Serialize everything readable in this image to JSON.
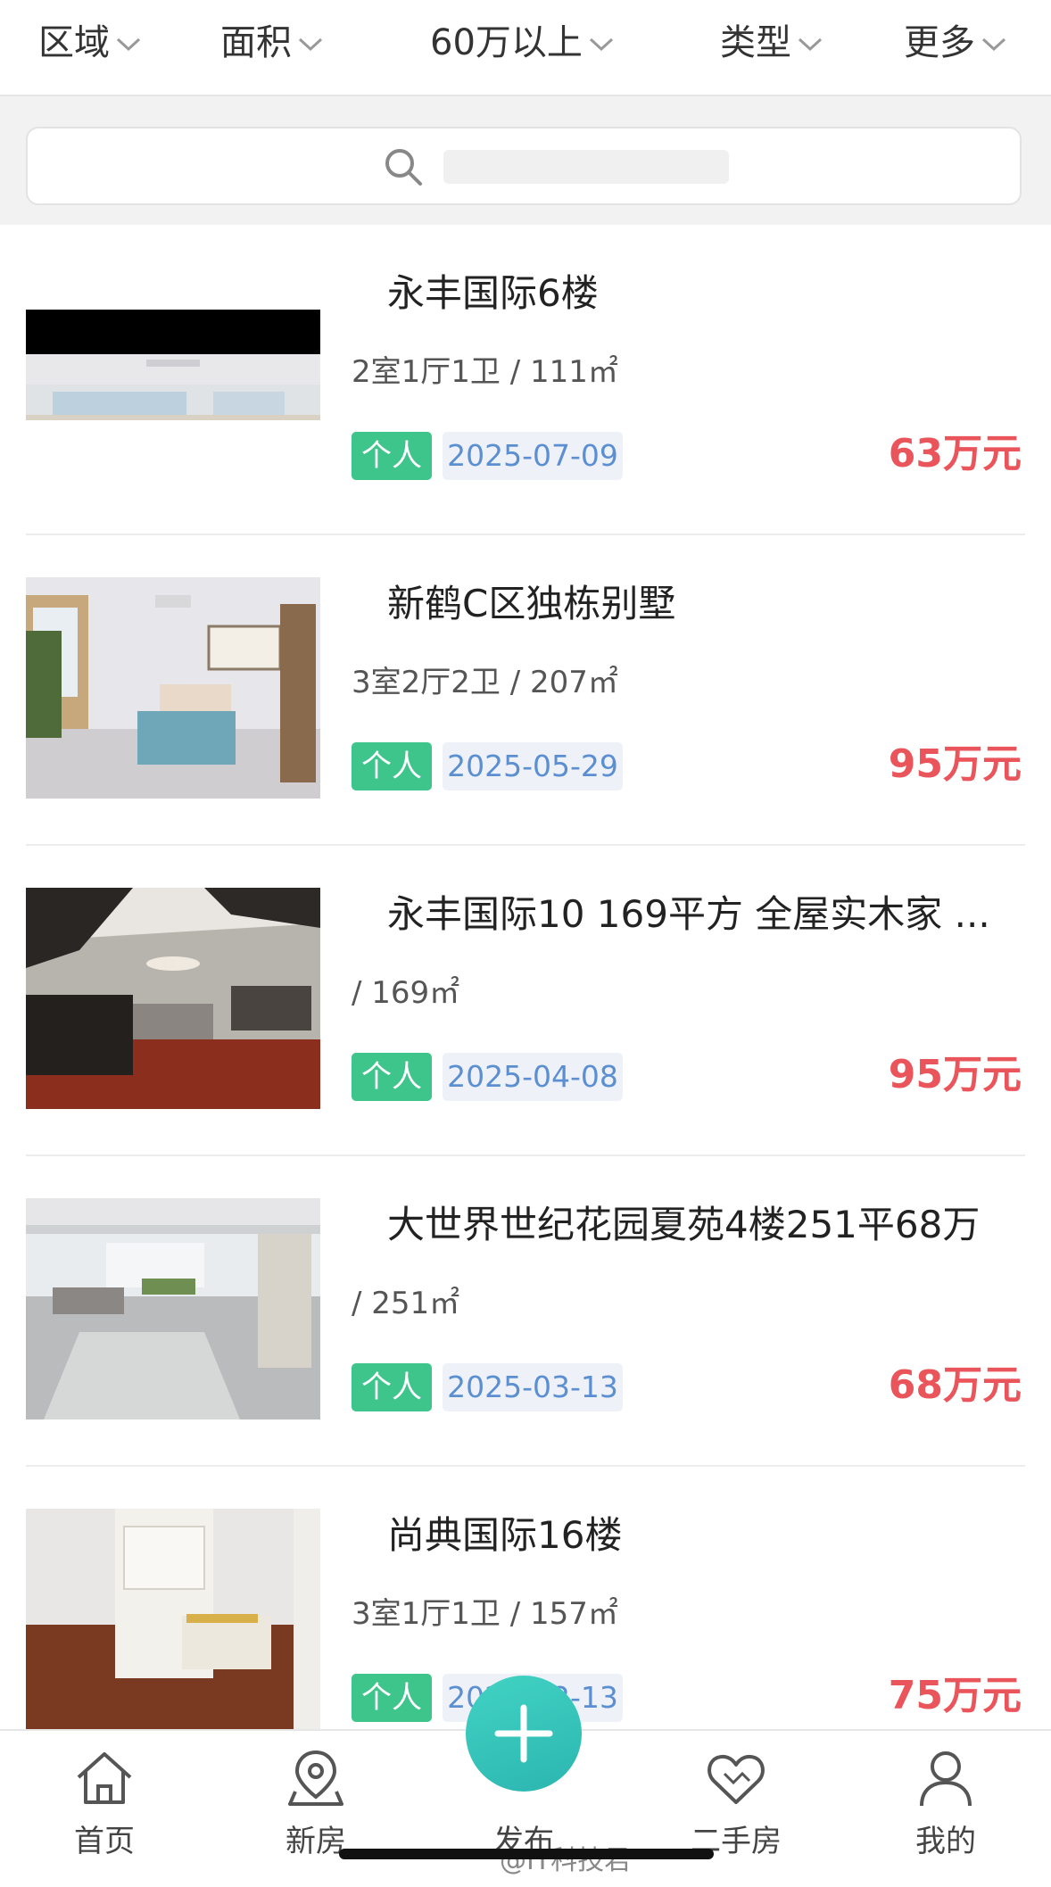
{
  "filters": [
    {
      "label": "区域"
    },
    {
      "label": "面积"
    },
    {
      "label": "60万以上"
    },
    {
      "label": "类型"
    },
    {
      "label": "更多"
    }
  ],
  "search": {
    "placeholder": ""
  },
  "listings": [
    {
      "title": "永丰国际6楼",
      "specs": "2室1厅1卫 / 111㎡",
      "tag": "个人",
      "date": "2025-07-09",
      "price": "63万元"
    },
    {
      "title": "新鹤C区独栋别墅",
      "specs": "3室2厅2卫 / 207㎡",
      "tag": "个人",
      "date": "2025-05-29",
      "price": "95万元"
    },
    {
      "title": "永丰国际10 169平方 全屋实木家 ...",
      "specs": "/ 169㎡",
      "tag": "个人",
      "date": "2025-04-08",
      "price": "95万元"
    },
    {
      "title": "大世界世纪花园夏苑4楼251平68万",
      "specs": "/ 251㎡",
      "tag": "个人",
      "date": "2025-03-13",
      "price": "68万元"
    },
    {
      "title": "尚典国际16楼",
      "specs": "3室1厅1卫 / 157㎡",
      "tag": "个人",
      "date": "2025-02-13",
      "price": "75万元"
    }
  ],
  "nav": {
    "home": "首页",
    "new_house": "新房",
    "publish": "发布",
    "second_hand": "二手房",
    "mine": "我的"
  },
  "watermark": "@IT科技君",
  "colors": {
    "price": "#e9555a",
    "tag_person_bg": "#3dc58c",
    "date_text": "#5b8fd1",
    "publish_button": "#2bb6b0"
  }
}
